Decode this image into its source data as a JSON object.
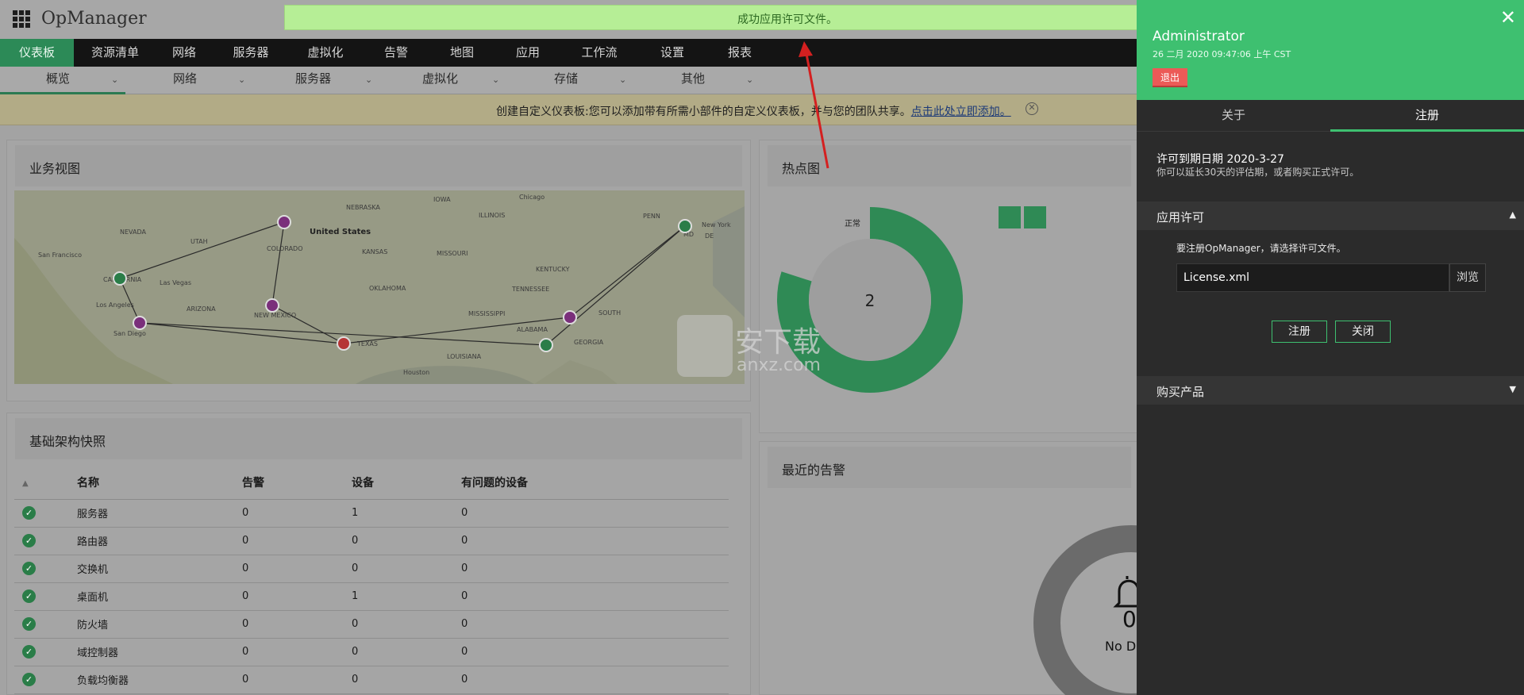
{
  "app": {
    "title": "OpManager"
  },
  "main_nav": [
    "仪表板",
    "资源清单",
    "网络",
    "服务器",
    "虚拟化",
    "告警",
    "地图",
    "应用",
    "工作流",
    "设置",
    "报表"
  ],
  "sub_nav": [
    "概览",
    "网络",
    "服务器",
    "虚拟化",
    "存储",
    "其他"
  ],
  "notice": {
    "text": "创建自定义仪表板:您可以添加带有所需小部件的自定义仪表板，并与您的团队共享。",
    "link": "点击此处立即添加。"
  },
  "toast": {
    "message": "成功应用许可文件。"
  },
  "business_view": {
    "title": "业务视图",
    "labels": [
      "NEVADA",
      "UTAH",
      "COLORADO",
      "United States",
      "NEBRASKA",
      "IOWA",
      "ILLINOIS",
      "Chicago",
      "KANSAS",
      "MISSOURI",
      "KENTUCKY",
      "PENN",
      "New York",
      "San Francisco",
      "CALIFORNIA",
      "Las Vegas",
      "ARIZONA",
      "NEW MEXICO",
      "OKLAHOMA",
      "TENNESSEE",
      "Los Angeles",
      "San Diego",
      "TEXAS",
      "MISSISSIPPI",
      "ALABAMA",
      "GEORGIA",
      "SOUTH",
      "Houston",
      "LOUISIANA",
      "MD",
      "DE"
    ]
  },
  "heatmap": {
    "title": "热点图",
    "status_label": "正常",
    "count": "2"
  },
  "recent_alarms": {
    "title": "最近的告警",
    "count": "0",
    "empty_text": "No Data"
  },
  "infra": {
    "title": "基础架构快照",
    "columns": [
      "名称",
      "告警",
      "设备",
      "有问题的设备"
    ],
    "rows": [
      {
        "name": "服务器",
        "alarms": "0",
        "devices": "1",
        "problem": "0"
      },
      {
        "name": "路由器",
        "alarms": "0",
        "devices": "0",
        "problem": "0"
      },
      {
        "name": "交换机",
        "alarms": "0",
        "devices": "0",
        "problem": "0"
      },
      {
        "name": "桌面机",
        "alarms": "0",
        "devices": "1",
        "problem": "0"
      },
      {
        "name": "防火墙",
        "alarms": "0",
        "devices": "0",
        "problem": "0"
      },
      {
        "name": "域控制器",
        "alarms": "0",
        "devices": "0",
        "problem": "0"
      },
      {
        "name": "负载均衡器",
        "alarms": "0",
        "devices": "0",
        "problem": "0"
      }
    ]
  },
  "watermark": {
    "text1": "安下载",
    "text2": "anxz.com"
  },
  "drawer": {
    "user": "Administrator",
    "datetime": "26 二月 2020 09:47:06 上午 CST",
    "logout": "退出",
    "tabs": [
      "关于",
      "注册"
    ],
    "expiry": "许可到期日期 2020-3-27",
    "expiry_note": "你可以延长30天的评估期，或者购买正式许可。",
    "apply_section": "应用许可",
    "apply_hint": "要注册OpManager，请选择许可文件。",
    "file_value": "License.xml",
    "browse": "浏览",
    "register_btn": "注册",
    "close_btn": "关闭",
    "buy_section": "购买产品"
  },
  "colors": {
    "accent_green": "#3ec070",
    "nav_active": "#2c8a57",
    "logout_red": "#ec5a57",
    "toast_bg": "#b6ee96",
    "arrow_red": "#d42020"
  }
}
